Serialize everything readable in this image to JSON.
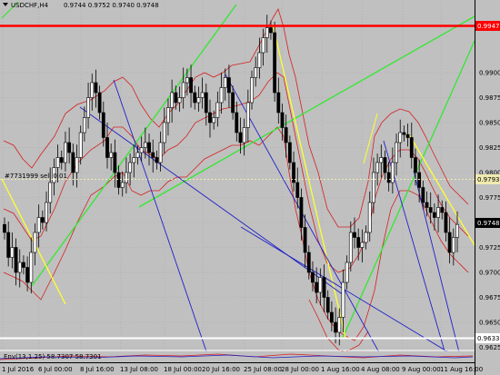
{
  "header": {
    "symbol_tf": "USDCHF,H4",
    "ohlc": "0.9744 0.9752 0.9740 0.9748"
  },
  "chart_data": {
    "type": "candlestick",
    "symbol": "USDCHF",
    "timeframe": "H4",
    "ylim": [
      0.9615,
      1.0
    ],
    "y_ticks": [
      "0.9900",
      "0.9875",
      "0.9850",
      "0.9825",
      "0.9800",
      "0.9775",
      "0.9750",
      "0.9725",
      "0.9700",
      "0.9675",
      "0.9650",
      "0.9625"
    ],
    "x_ticks": [
      "1 Jul 2016",
      "6 Jul 00:00",
      "8 Jul 16:00",
      "13 Jul 08:00",
      "18 Jul 00:00",
      "20 Jul 16:00",
      "25 Jul 08:00",
      "28 Jul 00:00",
      "1 Aug 16:00",
      "4 Aug 08:00",
      "9 Aug 00:00",
      "11 Aug 16:00"
    ],
    "price_lines": [
      {
        "label": "0.9947",
        "value": 0.9947,
        "color": "#ff0000"
      },
      {
        "label": "0.9793",
        "value": 0.9793,
        "color": "#e8e0a0"
      },
      {
        "label": "0.9748",
        "value": 0.9748,
        "color": "#000000"
      },
      {
        "label": "0.9633",
        "value": 0.9633,
        "color": "#ffffff"
      }
    ],
    "order_label": "#7731999 sell 0.01",
    "indicator_label": "Env(13,1.25) 58.7307 58.7301",
    "candles_close": [
      0.974,
      0.9715,
      0.9725,
      0.97,
      0.971,
      0.9705,
      0.969,
      0.972,
      0.974,
      0.9755,
      0.975,
      0.977,
      0.979,
      0.9805,
      0.9815,
      0.981,
      0.983,
      0.982,
      0.98,
      0.9815,
      0.984,
      0.9855,
      0.9875,
      0.989,
      0.988,
      0.986,
      0.9835,
      0.9815,
      0.982,
      0.98,
      0.9785,
      0.979,
      0.98,
      0.981,
      0.9815,
      0.982,
      0.9825,
      0.983,
      0.982,
      0.9815,
      0.981,
      0.983,
      0.985,
      0.9865,
      0.988,
      0.987,
      0.9875,
      0.989,
      0.9895,
      0.988,
      0.987,
      0.9875,
      0.988,
      0.986,
      0.985,
      0.9855,
      0.987,
      0.9885,
      0.9895,
      0.988,
      0.986,
      0.984,
      0.983,
      0.9845,
      0.987,
      0.9895,
      0.9905,
      0.992,
      0.9935,
      0.9945,
      0.994,
      0.988,
      0.986,
      0.9845,
      0.983,
      0.981,
      0.979,
      0.9775,
      0.9745,
      0.972,
      0.97,
      0.969,
      0.968,
      0.9695,
      0.9675,
      0.966,
      0.965,
      0.964,
      0.9655,
      0.969,
      0.971,
      0.974,
      0.9735,
      0.9725,
      0.973,
      0.974,
      0.977,
      0.98,
      0.981,
      0.9815,
      0.98,
      0.979,
      0.981,
      0.983,
      0.984,
      0.9838,
      0.9835,
      0.9815,
      0.98,
      0.9785,
      0.977,
      0.9765,
      0.976,
      0.9755,
      0.9765,
      0.976,
      0.974,
      0.972,
      0.9735,
      0.9748
    ]
  }
}
